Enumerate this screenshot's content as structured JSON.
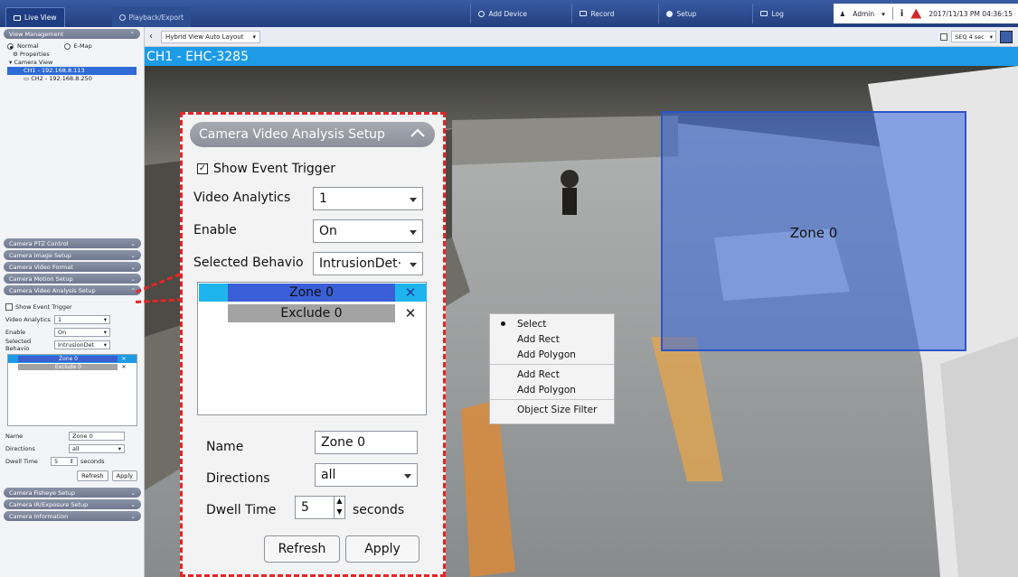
{
  "topbar": {
    "tab_live": "Live View",
    "tab_playback": "Playback/Export",
    "add_device": "Add Device",
    "record": "Record",
    "setup": "Setup",
    "log": "Log",
    "admin": "Admin",
    "datetime": "2017/11/13 PM 04:36:15"
  },
  "subbar": {
    "layout": "Hybrid View Auto Layout",
    "seq_label": "SEQ 4 sec"
  },
  "left": {
    "view_management": "View Management",
    "normal": "Normal",
    "emap": "E-Map",
    "properties": "Properties",
    "camera_view": "Camera View",
    "ch1": "CH1 - 192.168.8.113",
    "ch2": "CH2 - 192.168.8.250",
    "sections_top": [
      "Camera PTZ Control",
      "Camera Image Setup",
      "Camera Video Format",
      "Camera Motion Setup"
    ],
    "analysis_head": "Camera Video Analysis Setup",
    "show_event": "Show Event Trigger",
    "va_label": "Video Analytics",
    "va_value": "1",
    "enable_label": "Enable",
    "enable_value": "On",
    "behavior_label": "Selected Behavio",
    "behavior_value": "IntrusionDet",
    "zone0": "Zone 0",
    "exclude0": "Exclude 0",
    "name_label": "Name",
    "name_value": "Zone 0",
    "dir_label": "Directions",
    "dir_value": "all",
    "dwell_label": "Dwell Time",
    "dwell_value": "5",
    "seconds": "seconds",
    "refresh": "Refresh",
    "apply": "Apply",
    "sections_bottom": [
      "Camera Fisheye Setup",
      "Camera IR/Exposure Setup",
      "Camera Information"
    ]
  },
  "channel": {
    "title": "CH1 - EHC-3285"
  },
  "video": {
    "zone_label": "Zone 0",
    "context_menu": [
      "Select",
      "Add Rect",
      "Add Polygon",
      "Add Rect",
      "Add Polygon",
      "Object Size Filter"
    ]
  },
  "callout": {
    "title": "Camera Video Analysis Setup",
    "show_event": "Show Event Trigger",
    "va_label": "Video Analytics",
    "va_value": "1",
    "enable_label": "Enable",
    "enable_value": "On",
    "behavior_label": "Selected Behavio",
    "behavior_value": "IntrusionDet·",
    "zone0": "Zone 0",
    "exclude0": "Exclude 0",
    "name_label": "Name",
    "name_value": "Zone 0",
    "dir_label": "Directions",
    "dir_value": "all",
    "dwell_label": "Dwell Time",
    "dwell_value": "5",
    "seconds": "seconds",
    "refresh": "Refresh",
    "apply": "Apply"
  },
  "colors": {
    "accent": "#1e9be6",
    "zone_fill": "#3668dc",
    "callout_border": "#e32626"
  }
}
